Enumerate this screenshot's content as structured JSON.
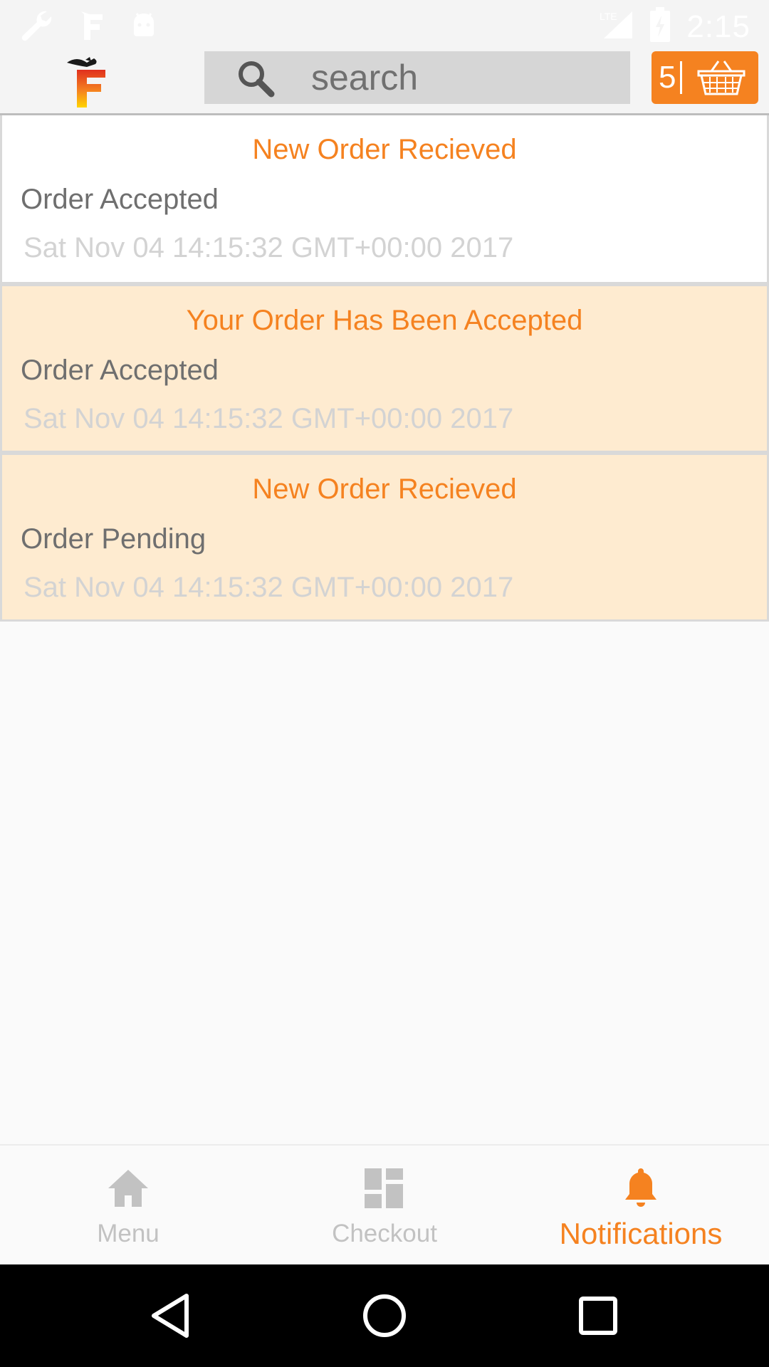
{
  "status_bar": {
    "time": "2:15",
    "network": "LTE",
    "icons": [
      "wrench-icon",
      "app-f-icon",
      "android-icon",
      "lte-signal-icon",
      "battery-charging-icon"
    ]
  },
  "header": {
    "logo": "F",
    "search": {
      "placeholder": "search",
      "value": ""
    },
    "cart": {
      "count": "5",
      "icon": "basket-icon"
    }
  },
  "notifications": [
    {
      "title": "New Order Recieved",
      "status": "Order Accepted",
      "date": "Sat Nov 04 14:15:32 GMT+00:00 2017",
      "state": "read"
    },
    {
      "title": "Your Order Has Been Accepted",
      "status": "Order Accepted",
      "date": "Sat Nov 04 14:15:32 GMT+00:00 2017",
      "state": "unread"
    },
    {
      "title": "New Order Recieved",
      "status": "Order Pending",
      "date": "Sat Nov 04 14:15:32 GMT+00:00 2017",
      "state": "unread"
    }
  ],
  "bottom_nav": {
    "items": [
      {
        "label": "Menu",
        "icon": "home-icon",
        "active": false
      },
      {
        "label": "Checkout",
        "icon": "dashboard-icon",
        "active": false
      },
      {
        "label": "Notifications",
        "icon": "bell-icon",
        "active": true
      }
    ]
  },
  "colors": {
    "accent": "#f58220",
    "unread_bg": "#feebd0",
    "inactive": "#c2c2c2"
  }
}
